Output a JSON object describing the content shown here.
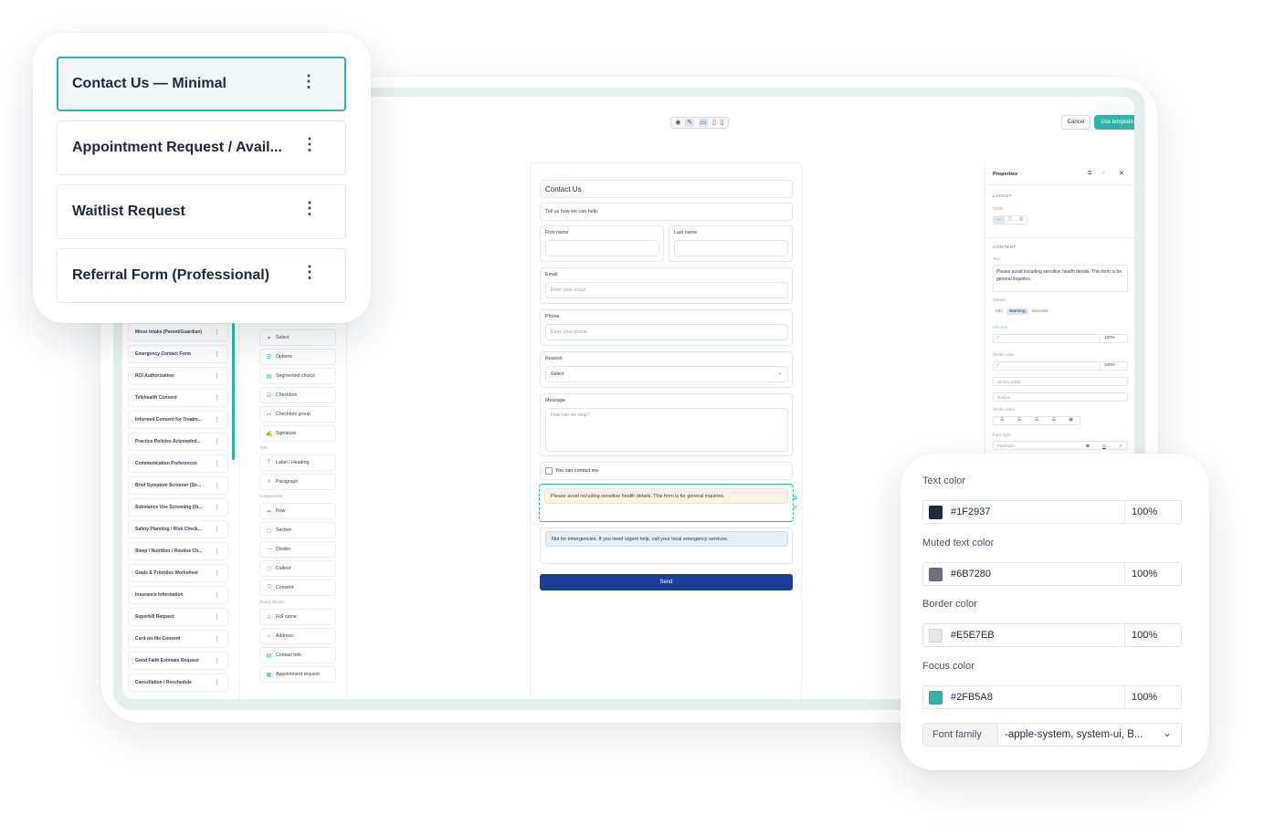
{
  "toolbar": {
    "cancel_label": "Cancel",
    "use_template_label": "Use template",
    "icons": [
      "eye-icon",
      "pencil-icon",
      "desktop-icon",
      "tablet-icon",
      "phone-icon"
    ]
  },
  "template_list": [
    {
      "label": "Contact Us — Minimal",
      "selected": true
    },
    {
      "label": "Appointment Request / Avail...",
      "selected": false
    },
    {
      "label": "Waitlist Request",
      "selected": false
    },
    {
      "label": "Referral Form (Professional)",
      "selected": false
    }
  ],
  "sidebar_templates": [
    "Minor Intake (Parent/Guardian)",
    "Emergency Contact Form",
    "ROI Authorization",
    "Telehealth Consent",
    "Informed Consent for Treatm...",
    "Practice Policies Acknowled...",
    "Communication Preferences",
    "Brief Symptom Screener (Str...",
    "Substance Use Screening (St...",
    "Safety Planning / Risk Check...",
    "Sleep / Nutrition / Routine Ch...",
    "Goals & Priorities Worksheet",
    "Insurance Information",
    "Superbill Request",
    "Card-on-file Consent",
    "Good Faith Estimate Request",
    "Cancellation / Reschedule"
  ],
  "palette": {
    "fields_items": [
      {
        "label": "Select",
        "icon": "select-icon"
      },
      {
        "label": "Options",
        "icon": "list-icon"
      },
      {
        "label": "Segmented choice",
        "icon": "segmented-icon"
      },
      {
        "label": "Checkbox",
        "icon": "checkbox-icon"
      },
      {
        "label": "Checkbox group",
        "icon": "checkbox-group-icon"
      },
      {
        "label": "Signature",
        "icon": "signature-icon"
      }
    ],
    "text_category": "Text",
    "text_items": [
      {
        "label": "Label / Heading",
        "icon": "heading-icon"
      },
      {
        "label": "Paragraph",
        "icon": "paragraph-icon"
      }
    ],
    "components_category": "Components",
    "component_items": [
      {
        "label": "Row",
        "icon": "row-icon"
      },
      {
        "label": "Section",
        "icon": "section-icon"
      },
      {
        "label": "Divider",
        "icon": "divider-icon"
      },
      {
        "label": "Callout",
        "icon": "info-icon"
      },
      {
        "label": "Consent",
        "icon": "shield-check-icon"
      }
    ],
    "ready_category": "Ready Blocks",
    "ready_items": [
      {
        "label": "Full name",
        "icon": "user-icon"
      },
      {
        "label": "Address",
        "icon": "home-icon"
      },
      {
        "label": "Contact info",
        "icon": "contact-card-icon"
      },
      {
        "label": "Appointment request",
        "icon": "calendar-icon"
      }
    ]
  },
  "form": {
    "title": "Contact Us",
    "subtitle": "Tell us how we can help.",
    "first_name_label": "First name",
    "last_name_label": "Last name",
    "email_label": "Email",
    "email_placeholder": "Enter your email",
    "phone_label": "Phone",
    "phone_placeholder": "Enter your phone",
    "reason_label": "Reason",
    "reason_value": "Select",
    "message_label": "Message",
    "message_placeholder": "How can we help?",
    "checkbox_label": "You can contact me",
    "warning_callout": "Please avoid including sensitive health details. This form is for general inquiries.",
    "info_callout": "Not for emergencies. If you need urgent help, call your local emergency services.",
    "submit_label": "Send"
  },
  "properties": {
    "title": "Properties",
    "layout_heading": "LAYOUT",
    "width_label": "Width",
    "content_heading": "CONTENT",
    "text_label": "Text",
    "text_value": "Please avoid including sensitive health details. This form is for general inquiries.",
    "variant_label": "Variant",
    "variants": [
      "Info",
      "Warning",
      "Success"
    ],
    "selected_variant": "Warning",
    "fill_color_label": "Fill color",
    "fill_opacity": "100%",
    "stroke_color_label": "Stroke color",
    "stroke_opacity": "100%",
    "stroke_width_label": "Stroke width",
    "radius_label": "Radius",
    "stroke_sides_label": "Stroke sides",
    "font_style_label": "Font Style",
    "font_size_label": "Font size",
    "bold_label": "B",
    "underline_label": "U",
    "italic_label": "I"
  },
  "colors": {
    "items": [
      {
        "label": "Text color",
        "hex": "#1F2937",
        "opacity": "100%"
      },
      {
        "label": "Muted text color",
        "hex": "#6B7280",
        "opacity": "100%"
      },
      {
        "label": "Border color",
        "hex": "#E5E7EB",
        "opacity": "100%"
      },
      {
        "label": "Focus color",
        "hex": "#2FB5A8",
        "opacity": "100%"
      }
    ],
    "font_family_label": "Font family",
    "font_family_value": "-apple-system, system-ui, B..."
  },
  "theme": {
    "accent": "#2FB5A8",
    "submit_button": "#1A3F96",
    "warning_bg": "#FDF3E4",
    "info_bg": "#E8EEF6"
  }
}
